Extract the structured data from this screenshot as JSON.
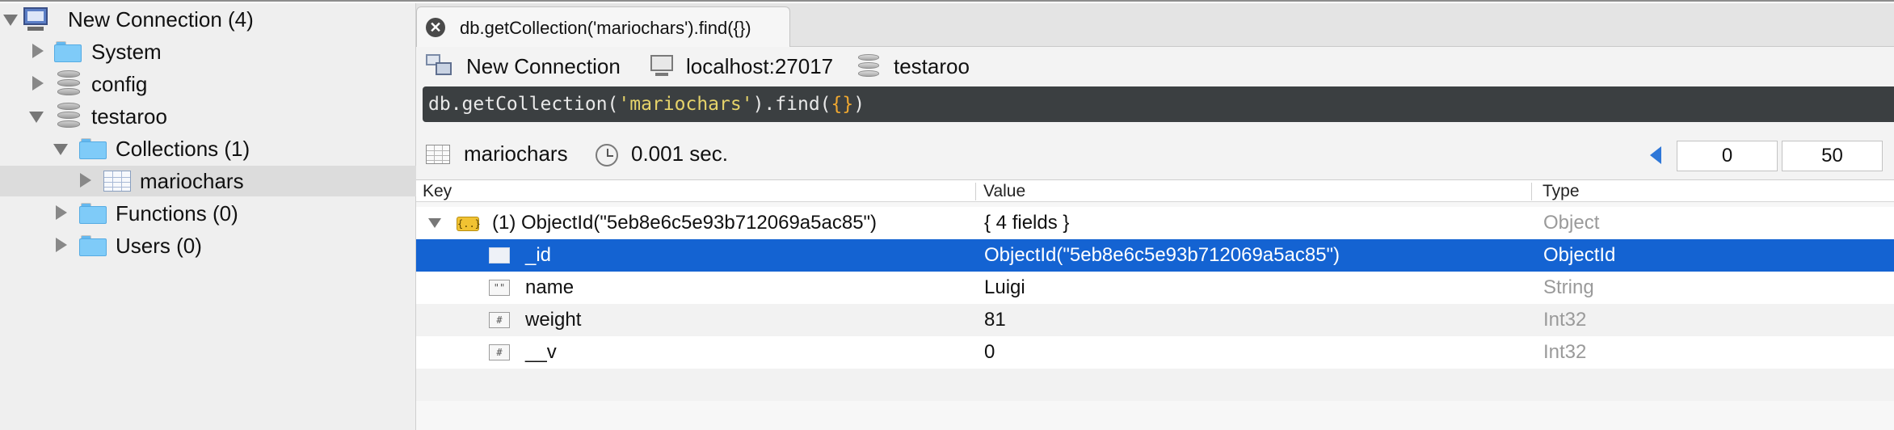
{
  "sidebar": {
    "items": [
      {
        "label": "New Connection (4)",
        "icon": "computer-icon",
        "expanded": true
      },
      {
        "label": "System",
        "icon": "folder-icon",
        "expanded": false
      },
      {
        "label": "config",
        "icon": "database-icon",
        "expanded": false
      },
      {
        "label": "testaroo",
        "icon": "database-icon",
        "expanded": true
      },
      {
        "label": "Collections (1)",
        "icon": "folder-icon",
        "expanded": true
      },
      {
        "label": "mariochars",
        "icon": "collection-grid-icon",
        "expanded": false,
        "selected": true
      },
      {
        "label": "Functions (0)",
        "icon": "folder-icon",
        "expanded": false
      },
      {
        "label": "Users (0)",
        "icon": "folder-icon",
        "expanded": false
      }
    ]
  },
  "tab": {
    "title": "db.getCollection('mariochars').find({})",
    "close_glyph": "✕"
  },
  "info": {
    "connection": "New Connection",
    "host": "localhost:27017",
    "database": "testaroo"
  },
  "query": {
    "prefix": "db.getCollection(",
    "string": "'mariochars'",
    "middle": ").find(",
    "arg": "{}",
    "suffix": ")"
  },
  "result": {
    "collection": "mariochars",
    "time": "0.001 sec.",
    "skip": "0",
    "limit": "50"
  },
  "table": {
    "headers": {
      "key": "Key",
      "value": "Value",
      "type": "Type"
    },
    "rows": [
      {
        "key": "(1) ObjectId(\"5eb8e6c5e93b712069a5ac85\")",
        "value": "{ 4 fields }",
        "type": "Object",
        "icon": "object-icon",
        "icon_text": "{..}"
      },
      {
        "key": "_id",
        "value": "ObjectId(\"5eb8e6c5e93b712069a5ac85\")",
        "type": "ObjectId",
        "icon": "objectid-field-icon",
        "icon_text": ""
      },
      {
        "key": "name",
        "value": "Luigi",
        "type": "String",
        "icon": "string-field-icon",
        "icon_text": "\"\""
      },
      {
        "key": "weight",
        "value": "81",
        "type": "Int32",
        "icon": "number-field-icon",
        "icon_text": "#"
      },
      {
        "key": "__v",
        "value": "0",
        "type": "Int32",
        "icon": "number-field-icon",
        "icon_text": "#"
      }
    ]
  },
  "colors": {
    "selection": "#1463d2",
    "query_bg": "#3b3f41",
    "query_string": "#e6d36a",
    "query_brace": "#f0a830"
  }
}
